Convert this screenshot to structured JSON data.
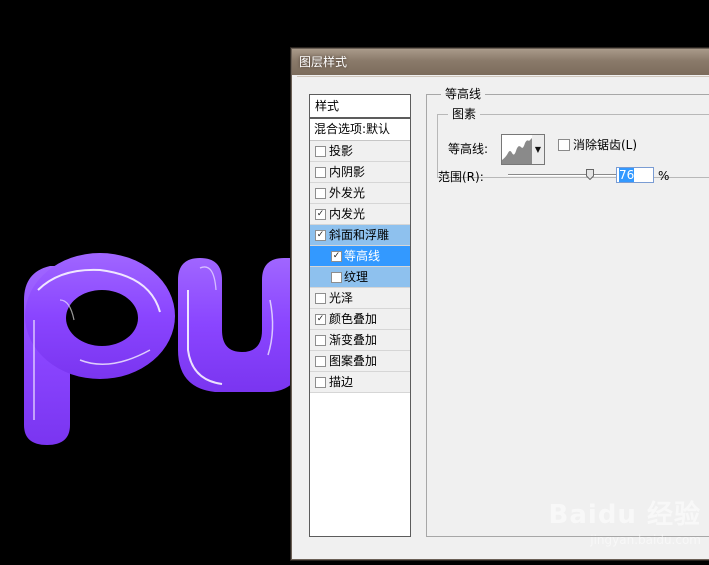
{
  "dialog": {
    "title": "图层样式"
  },
  "styles": {
    "header": "样式",
    "blend_options": "混合选项:默认",
    "items": [
      {
        "label": "投影",
        "checked": false
      },
      {
        "label": "内阴影",
        "checked": false
      },
      {
        "label": "外发光",
        "checked": false
      },
      {
        "label": "内发光",
        "checked": true
      },
      {
        "label": "斜面和浮雕",
        "checked": true
      },
      {
        "label": "等高线",
        "checked": true
      },
      {
        "label": "纹理",
        "checked": false
      },
      {
        "label": "光泽",
        "checked": false
      },
      {
        "label": "颜色叠加",
        "checked": true
      },
      {
        "label": "渐变叠加",
        "checked": false
      },
      {
        "label": "图案叠加",
        "checked": false
      },
      {
        "label": "描边",
        "checked": false
      }
    ]
  },
  "contour": {
    "group_title": "等高线",
    "elements_title": "图素",
    "contour_label": "等高线:",
    "anti_alias_label": "消除锯齿(L)",
    "anti_alias_checked": false,
    "range_label": "范围(R):",
    "range_value": "76",
    "range_unit": "%",
    "range_fraction": 0.76
  },
  "canvas_text": "pu",
  "watermark": {
    "brand": "Baidu 经验",
    "url": "jingyan.baidu.com"
  },
  "colors": {
    "text_fill": "#8a45ff",
    "selected_row": "#8ec1ee",
    "current_row": "#3399ff"
  }
}
